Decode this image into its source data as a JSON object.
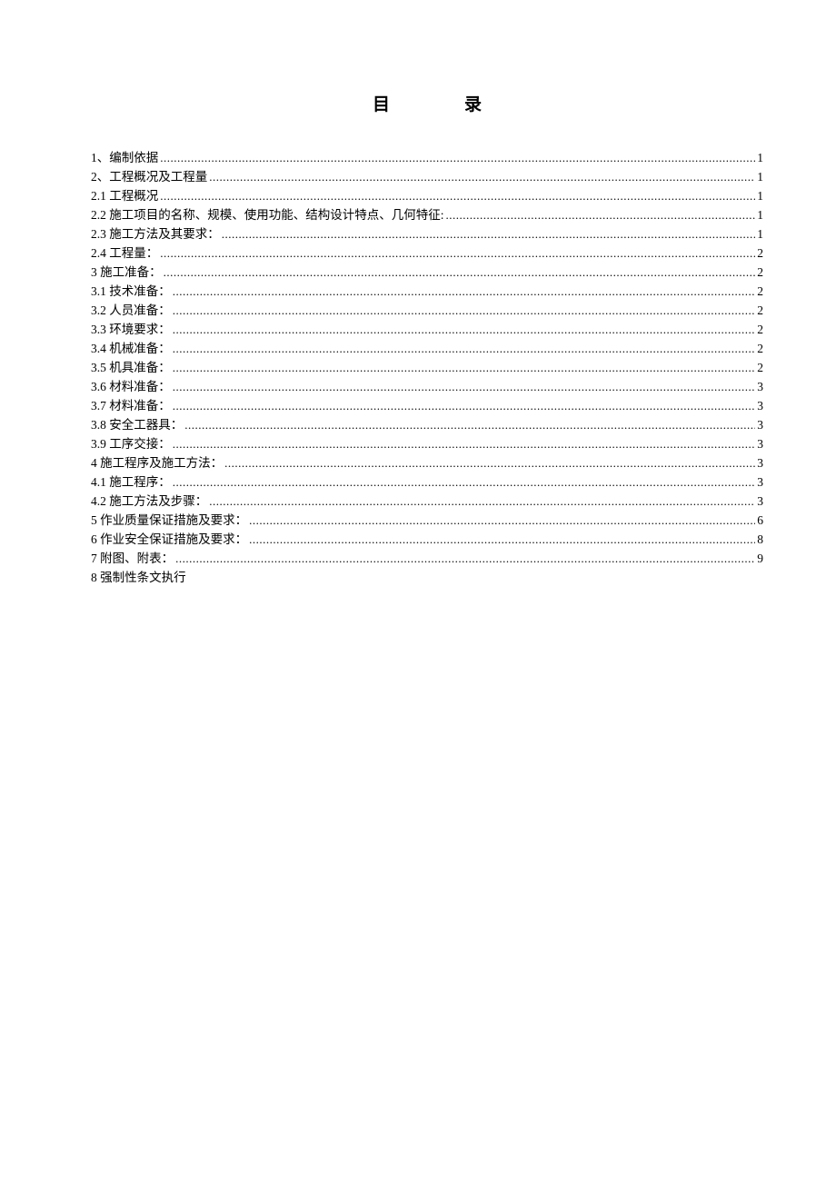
{
  "title": "目录",
  "entries": [
    {
      "label": "1、编制依据 ",
      "page": "1"
    },
    {
      "label": "2、工程概况及工程量 ",
      "page": "1"
    },
    {
      "label": "2.1 工程概况 ",
      "page": "1"
    },
    {
      "label": "2.2 施工项目的名称、规模、使用功能、结构设计特点、几何特征: ",
      "page": "1"
    },
    {
      "label": "2.3 施工方法及其要求：  ",
      "page": "1"
    },
    {
      "label": "2.4 工程量：  ",
      "page": "2"
    },
    {
      "label": "3 施工准备：  ",
      "page": "2"
    },
    {
      "label": "3.1 技术准备：  ",
      "page": "2"
    },
    {
      "label": "3.2 人员准备：  ",
      "page": "2"
    },
    {
      "label": "3.3 环境要求：  ",
      "page": "2"
    },
    {
      "label": "3.4 机械准备：  ",
      "page": "2"
    },
    {
      "label": "3.5 机具准备：  ",
      "page": "2"
    },
    {
      "label": "3.6 材料准备：  ",
      "page": "3"
    },
    {
      "label": "3.7 材料准备：  ",
      "page": "3"
    },
    {
      "label": "3.8 安全工器具：  ",
      "page": "3"
    },
    {
      "label": "3.9 工序交接：  ",
      "page": "3"
    },
    {
      "label": "4 施工程序及施工方法：  ",
      "page": "3"
    },
    {
      "label": "4.1 施工程序：  ",
      "page": "3"
    },
    {
      "label": "4.2 施工方法及步骤：  ",
      "page": "3"
    },
    {
      "label": "5 作业质量保证措施及要求：  ",
      "page": "6"
    },
    {
      "label": "6 作业安全保证措施及要求：  ",
      "page": "8"
    },
    {
      "label": "7 附图、附表：  ",
      "page": "9"
    },
    {
      "label": "8 强制性条文执行",
      "page": ""
    }
  ]
}
